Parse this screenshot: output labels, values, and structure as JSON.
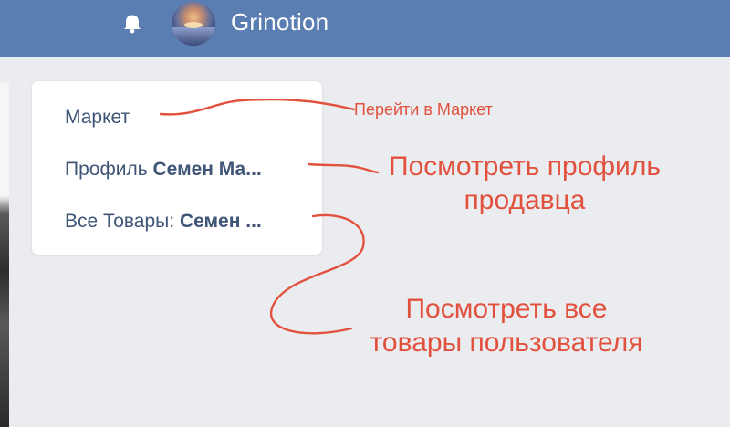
{
  "header": {
    "username": "Grinotion",
    "bell_icon": "bell-icon",
    "background_color": "#5a7db2"
  },
  "menu": {
    "items": [
      {
        "label": "Маркет"
      },
      {
        "label": "Профиль ",
        "bold": "Семен Ма..."
      },
      {
        "label": "Все Товары: ",
        "bold": "Семен ..."
      }
    ]
  },
  "annotations": {
    "market": "Перейти в Маркет",
    "profile_line1": "Посмотреть профиль",
    "profile_line2": "продавца",
    "goods_line1": "Посмотреть все",
    "goods_line2": "товары пользователя",
    "color": "#e2513e"
  }
}
